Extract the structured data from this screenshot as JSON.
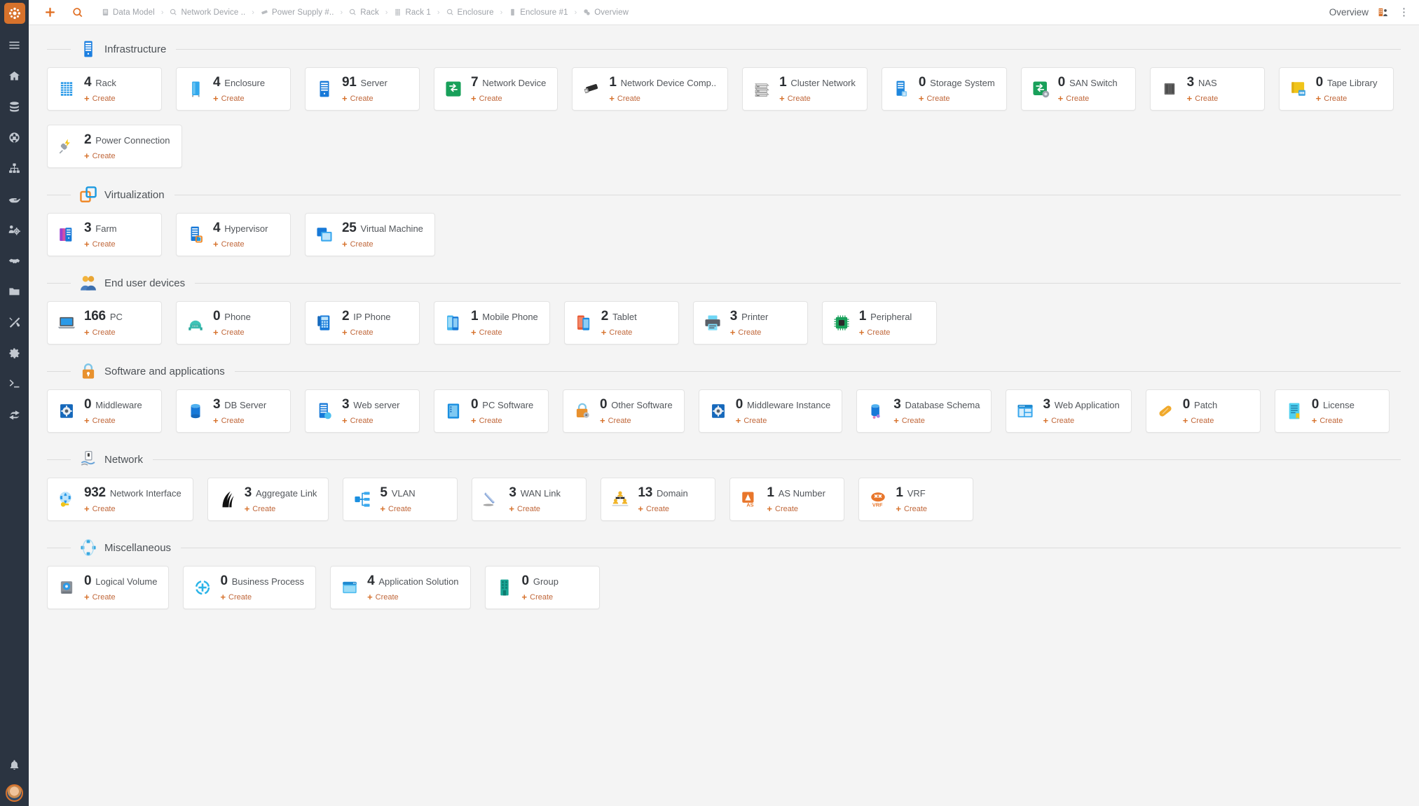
{
  "app": {
    "logo_icon": "itop-logo-icon",
    "brand_color": "#d7722c"
  },
  "sidebar": {
    "items": [
      {
        "name": "menu-toggle",
        "icon": "hamburger-icon"
      },
      {
        "name": "welcome",
        "icon": "home-icon"
      },
      {
        "name": "data-sources",
        "icon": "database-icon"
      },
      {
        "name": "configuration-management",
        "icon": "globe-icon"
      },
      {
        "name": "service-management",
        "icon": "org-chart-icon"
      },
      {
        "name": "request-management",
        "icon": "hand-icon"
      },
      {
        "name": "incident-management",
        "icon": "gears-people-icon"
      },
      {
        "name": "change-management",
        "icon": "handshake-icon"
      },
      {
        "name": "documents",
        "icon": "folder-icon"
      },
      {
        "name": "tools",
        "icon": "tools-icon"
      },
      {
        "name": "admin-tools",
        "icon": "gear-icon"
      },
      {
        "name": "console",
        "icon": "terminal-icon"
      },
      {
        "name": "connections",
        "icon": "share-icon"
      }
    ],
    "bottom": [
      {
        "name": "notifications",
        "icon": "bell-icon"
      },
      {
        "name": "user-avatar",
        "icon": "avatar-icon"
      }
    ]
  },
  "topbar": {
    "new_icon": "plus-icon",
    "search_icon": "search-icon",
    "title": "Overview",
    "view_icon": "dashboard-view-icon",
    "menu_icon": "kebab-menu-icon",
    "breadcrumb": [
      {
        "label": "Data Model",
        "icon": "datamodel-icon"
      },
      {
        "label": "Network Device ..",
        "icon": "search-icon"
      },
      {
        "label": "Power Supply #..",
        "icon": "powersupply-icon"
      },
      {
        "label": "Rack",
        "icon": "search-icon"
      },
      {
        "label": "Rack 1",
        "icon": "rack-icon"
      },
      {
        "label": "Enclosure",
        "icon": "search-icon"
      },
      {
        "label": "Enclosure #1",
        "icon": "enclosure-icon"
      },
      {
        "label": "Overview",
        "icon": "overview-icon"
      }
    ],
    "separator": "›"
  },
  "create_label": "Create",
  "sections": [
    {
      "title": "Infrastructure",
      "icon": "server-rack-icon",
      "cards": [
        {
          "count": "4",
          "label": "Rack",
          "icon": "rack-icon"
        },
        {
          "count": "4",
          "label": "Enclosure",
          "icon": "enclosure-icon"
        },
        {
          "count": "91",
          "label": "Server",
          "icon": "server-icon"
        },
        {
          "count": "7",
          "label": "Network Device",
          "icon": "network-device-icon"
        },
        {
          "count": "1",
          "label": "Network Device Comp..",
          "icon": "network-device-component-icon"
        },
        {
          "count": "1",
          "label": "Cluster Network",
          "icon": "cluster-network-icon"
        },
        {
          "count": "0",
          "label": "Storage System",
          "icon": "storage-system-icon"
        },
        {
          "count": "0",
          "label": "SAN Switch",
          "icon": "san-switch-icon"
        },
        {
          "count": "3",
          "label": "NAS",
          "icon": "nas-icon"
        },
        {
          "count": "0",
          "label": "Tape Library",
          "icon": "tape-library-icon"
        },
        {
          "count": "2",
          "label": "Power Connection",
          "icon": "power-connection-icon"
        }
      ]
    },
    {
      "title": "Virtualization",
      "icon": "virtualization-icon",
      "cards": [
        {
          "count": "3",
          "label": "Farm",
          "icon": "farm-icon"
        },
        {
          "count": "4",
          "label": "Hypervisor",
          "icon": "hypervisor-icon"
        },
        {
          "count": "25",
          "label": "Virtual Machine",
          "icon": "virtual-machine-icon"
        }
      ]
    },
    {
      "title": "End user devices",
      "icon": "end-users-icon",
      "cards": [
        {
          "count": "166",
          "label": "PC",
          "icon": "pc-icon"
        },
        {
          "count": "0",
          "label": "Phone",
          "icon": "phone-icon"
        },
        {
          "count": "2",
          "label": "IP Phone",
          "icon": "ip-phone-icon"
        },
        {
          "count": "1",
          "label": "Mobile Phone",
          "icon": "mobile-phone-icon"
        },
        {
          "count": "2",
          "label": "Tablet",
          "icon": "tablet-icon"
        },
        {
          "count": "3",
          "label": "Printer",
          "icon": "printer-icon"
        },
        {
          "count": "1",
          "label": "Peripheral",
          "icon": "peripheral-icon"
        }
      ]
    },
    {
      "title": "Software and applications",
      "icon": "software-lock-icon",
      "cards": [
        {
          "count": "0",
          "label": "Middleware",
          "icon": "middleware-icon"
        },
        {
          "count": "3",
          "label": "DB Server",
          "icon": "db-server-icon"
        },
        {
          "count": "3",
          "label": "Web server",
          "icon": "web-server-icon"
        },
        {
          "count": "0",
          "label": "PC Software",
          "icon": "pc-software-icon"
        },
        {
          "count": "0",
          "label": "Other Software",
          "icon": "other-software-icon"
        },
        {
          "count": "0",
          "label": "Middleware Instance",
          "icon": "middleware-instance-icon"
        },
        {
          "count": "3",
          "label": "Database Schema",
          "icon": "database-schema-icon"
        },
        {
          "count": "3",
          "label": "Web Application",
          "icon": "web-application-icon"
        },
        {
          "count": "0",
          "label": "Patch",
          "icon": "patch-icon"
        },
        {
          "count": "0",
          "label": "License",
          "icon": "license-icon"
        }
      ]
    },
    {
      "title": "Network",
      "icon": "network-icon",
      "cards": [
        {
          "count": "932",
          "label": "Network Interface",
          "icon": "network-interface-icon"
        },
        {
          "count": "3",
          "label": "Aggregate Link",
          "icon": "aggregate-link-icon"
        },
        {
          "count": "5",
          "label": "VLAN",
          "icon": "vlan-icon"
        },
        {
          "count": "3",
          "label": "WAN Link",
          "icon": "wan-link-icon"
        },
        {
          "count": "13",
          "label": "Domain",
          "icon": "domain-icon"
        },
        {
          "count": "1",
          "label": "AS Number",
          "icon": "as-number-icon"
        },
        {
          "count": "1",
          "label": "VRF",
          "icon": "vrf-icon"
        }
      ]
    },
    {
      "title": "Miscellaneous",
      "icon": "miscellaneous-icon",
      "cards": [
        {
          "count": "0",
          "label": "Logical Volume",
          "icon": "logical-volume-icon"
        },
        {
          "count": "0",
          "label": "Business Process",
          "icon": "business-process-icon"
        },
        {
          "count": "4",
          "label": "Application Solution",
          "icon": "application-solution-icon"
        },
        {
          "count": "0",
          "label": "Group",
          "icon": "group-icon"
        }
      ]
    }
  ]
}
